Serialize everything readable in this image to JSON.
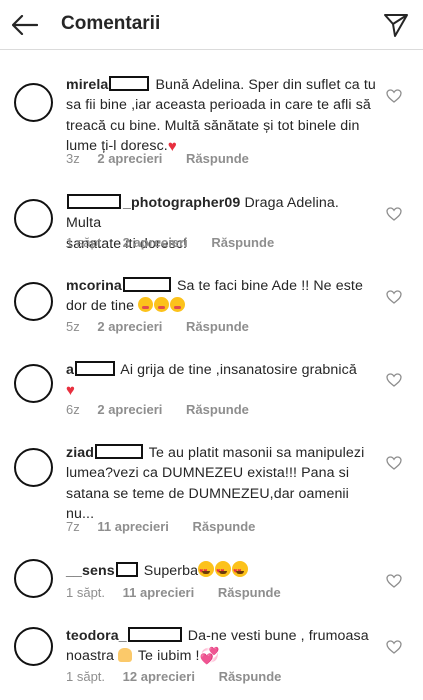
{
  "header": {
    "title": "Comentarii",
    "back_icon": "back-arrow-icon",
    "send_icon": "paper-plane-icon"
  },
  "colors": {
    "text": "#262626",
    "meta": "#8e8e8e",
    "divider": "#dbdbdb",
    "heart": "#e8303f"
  },
  "comments": [
    {
      "username": "mirela",
      "lines": [
        "Bună Adelina. Sper din suflet ca tu",
        "sa fii bine ,iar aceasta perioada in care te afli să",
        "treacă cu bine. Multă sănătate și tot binele din",
        "lume ți-l doresc."
      ],
      "time": "3z",
      "likes": "2 aprecieri",
      "reply": "Răspunde"
    },
    {
      "username": "_photographer09",
      "lines": [
        "Draga Adelina. Multa",
        "sanatate iti doresc!"
      ],
      "time": "1 săpt.",
      "likes": "2 aprecieri",
      "reply": "Răspunde"
    },
    {
      "username": "mcorina",
      "lines": [
        "Sa te faci bine Ade !! Ne este",
        "dor de tine "
      ],
      "time": "5z",
      "likes": "2 aprecieri",
      "reply": "Răspunde"
    },
    {
      "username": "a",
      "lines": [
        "Ai grija de tine ,insanatosire grabnică",
        ""
      ],
      "time": "6z",
      "likes": "2 aprecieri",
      "reply": "Răspunde"
    },
    {
      "username": "ziad",
      "lines": [
        "Te au platit masonii sa manipulezi",
        "lumea?vezi ca DUMNEZEU exista!!! Pana si",
        "satana se teme de DUMNEZEU,dar oamenii",
        "nu..."
      ],
      "time": "7z",
      "likes": "11 aprecieri",
      "reply": "Răspunde"
    },
    {
      "username": "__sens",
      "lines": [
        "Superba"
      ],
      "time": "1 săpt.",
      "likes": "11 aprecieri",
      "reply": "Răspunde"
    },
    {
      "username": "teodora_",
      "lines": [
        "Da-ne vesti bune , frumoasa",
        "noastra ",
        " Te iubim !"
      ],
      "time": "1 săpt.",
      "likes": "12 aprecieri",
      "reply": "Răspunde"
    }
  ]
}
